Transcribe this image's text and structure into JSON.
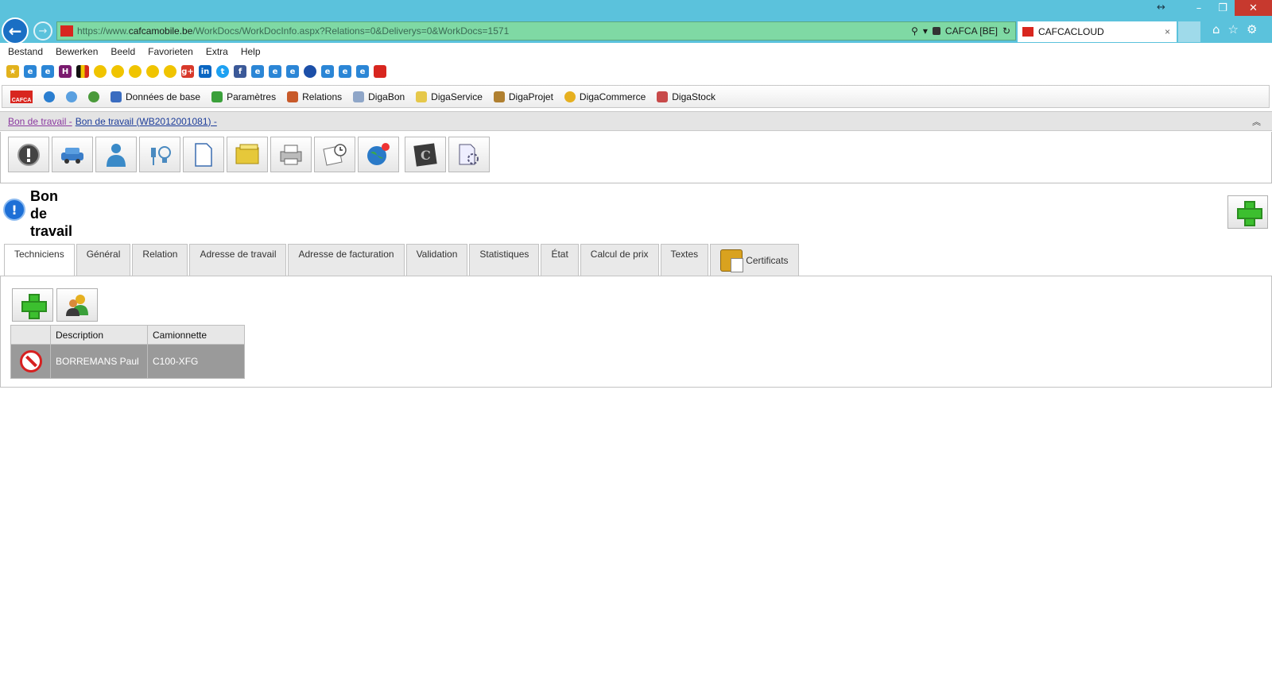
{
  "browser": {
    "url_prefix": "https://www.",
    "url_domain": "cafcamobile.be",
    "url_path": "/WorkDocs/WorkDocInfo.aspx?Relations=0&Deliverys=0&WorkDocs=1571",
    "site_identity": "CAFCA [BE]",
    "tab_title": "CAFCACLOUD",
    "tab_close": "×",
    "menu": [
      "Bestand",
      "Bewerken",
      "Beeld",
      "Favorieten",
      "Extra",
      "Help"
    ],
    "window_icons": [
      "minimize-icon",
      "restore-icon",
      "close-icon"
    ],
    "toolbar_icons": [
      "home-icon",
      "favorites-star-icon",
      "settings-gear-icon"
    ]
  },
  "app_toolbar": {
    "items": [
      "Données de base",
      "Paramètres",
      "Relations",
      "DigaBon",
      "DigaService",
      "DigaProjet",
      "DigaCommerce",
      "DigaStock"
    ]
  },
  "breadcrumb": {
    "part1": "Bon de travail -",
    "part2": "Bon de travail (WB2012001081) -"
  },
  "page": {
    "title_line1": "Bon",
    "title_line2": "de",
    "title_line3": "travail"
  },
  "tabs": [
    "Techniciens",
    "Général",
    "Relation",
    "Adresse de travail",
    "Adresse de facturation",
    "Validation",
    "Statistiques",
    "État",
    "Calcul de prix",
    "Textes",
    "Certificats"
  ],
  "technicians_table": {
    "columns": [
      "",
      "Description",
      "Camionnette"
    ],
    "rows": [
      {
        "description": "BORREMANS Paul",
        "van": "C100-XFG"
      }
    ]
  }
}
